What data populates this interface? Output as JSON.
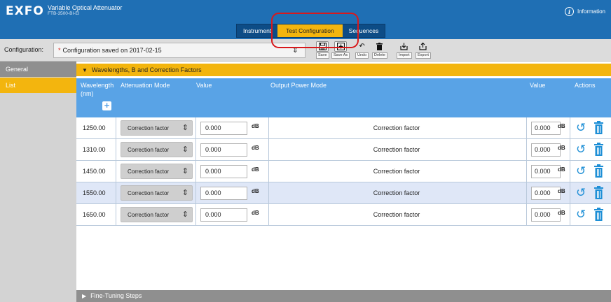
{
  "header": {
    "logo": "EXFO",
    "app_title": "Variable Optical Attenuator",
    "model": "FTB-3500-BI-EI",
    "info_label": "Information",
    "tabs": [
      {
        "label": "Instrument",
        "active": false
      },
      {
        "label": "Test Configuration",
        "active": true
      },
      {
        "label": "Sequences",
        "active": false
      }
    ]
  },
  "configbar": {
    "label": "Configuration:",
    "asterisk": "*",
    "value": "Configuration saved on 2017-02-15",
    "tools": {
      "save": "Save",
      "save_as": "Save As",
      "undo": "Undo",
      "delete": "Delete",
      "import": "Import",
      "export": "Export"
    }
  },
  "sidebar": {
    "items": [
      {
        "label": "General",
        "selected": false
      },
      {
        "label": "List",
        "selected": true
      }
    ]
  },
  "section": {
    "title": "Wavelengths, B and Correction Factors",
    "collapsed_title": "Fine-Tuning Steps"
  },
  "table": {
    "headers": {
      "wavelength": "Wavelength",
      "wavelength_unit": "(nm)",
      "attenuation_mode": "Attenuation Mode",
      "value": "Value",
      "output_power_mode": "Output Power Mode",
      "value2": "Value",
      "actions": "Actions"
    },
    "unit": "dB",
    "rows": [
      {
        "wavelength": "1250.00",
        "mode": "Correction factor",
        "value": "0.000",
        "output_mode": "Correction factor",
        "value2": "0.000",
        "selected": false
      },
      {
        "wavelength": "1310.00",
        "mode": "Correction factor",
        "value": "0.000",
        "output_mode": "Correction factor",
        "value2": "0.000",
        "selected": false
      },
      {
        "wavelength": "1450.00",
        "mode": "Correction factor",
        "value": "0.000",
        "output_mode": "Correction factor",
        "value2": "0.000",
        "selected": false
      },
      {
        "wavelength": "1550.00",
        "mode": "Correction factor",
        "value": "0.000",
        "output_mode": "Correction factor",
        "value2": "0.000",
        "selected": true
      },
      {
        "wavelength": "1650.00",
        "mode": "Correction factor",
        "value": "0.000",
        "output_mode": "Correction factor",
        "value2": "0.000",
        "selected": false
      }
    ]
  },
  "colors": {
    "header_blue": "#1f6fb4",
    "accent_yellow": "#f3b50e",
    "table_header_blue": "#59a3e6",
    "action_blue": "#1e8fd6",
    "highlight_red": "#d8191c"
  }
}
